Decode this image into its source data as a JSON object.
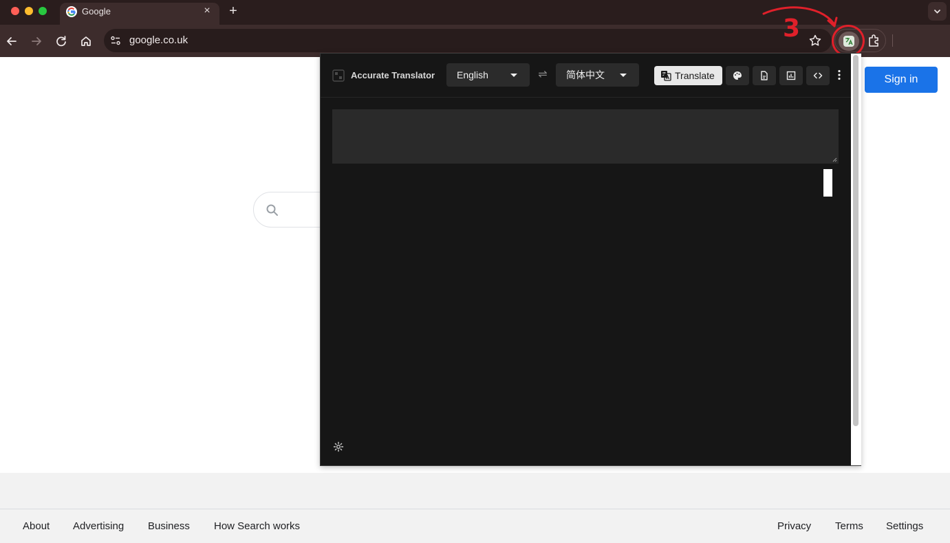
{
  "browser": {
    "tab": {
      "title": "Google",
      "close_glyph": "×"
    },
    "new_tab_glyph": "+",
    "url": "google.co.uk",
    "icons": [
      "back-icon",
      "forward-icon",
      "reload-icon",
      "home-icon",
      "site-info-icon",
      "bookmark-star-icon",
      "translator-extension-icon",
      "extensions-puzzle-icon",
      "tab-search-chevron-icon"
    ]
  },
  "annotation": {
    "number": "3",
    "color": "#e0202a"
  },
  "page": {
    "sign_in": "Sign in",
    "footer": {
      "left": [
        "About",
        "Advertising",
        "Business",
        "How Search works"
      ],
      "right": [
        "Privacy",
        "Terms",
        "Settings"
      ]
    }
  },
  "popup": {
    "app_name": "Accurate Translator",
    "source_lang": "English",
    "target_lang": "简体中文",
    "swap_glyph": "⇌",
    "translate_label": "Translate",
    "input_value": "",
    "tool_icons": [
      "palette-icon",
      "document-icon",
      "chart-icon",
      "code-icon",
      "more-vert-icon",
      "settings-icon"
    ]
  },
  "colors": {
    "chrome_dark": "#2a1d1d",
    "toolbar": "#3d2c2c",
    "popup_bg": "#161616",
    "sign_in_blue": "#1a73e8"
  }
}
